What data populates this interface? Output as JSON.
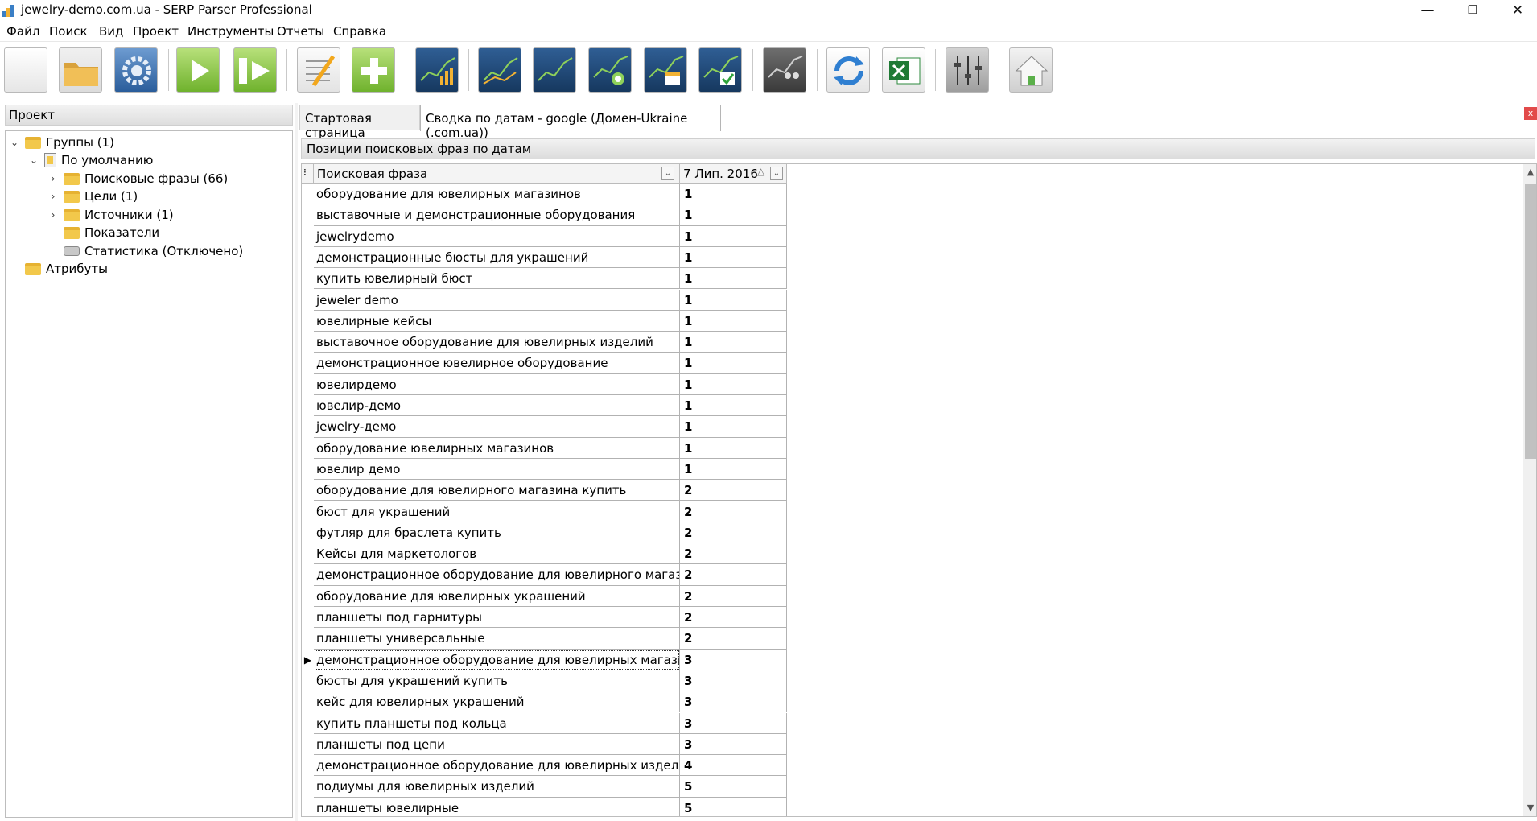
{
  "window": {
    "title": "jewelry-demo.com.ua - SERP Parser Professional",
    "minimize": "—",
    "restore": "❐",
    "close": "✕"
  },
  "menu": [
    "Файл",
    "Поиск",
    "Вид",
    "Проект",
    "Инструменты",
    "Отчеты",
    "Справка"
  ],
  "toolbar": {
    "icons": [
      "new-project-icon",
      "open-folder-icon",
      "settings-gear-icon",
      "run-icon",
      "run-checklist-icon",
      "edit-notes-icon",
      "add-icon",
      "chart-bars-icon",
      "chart-line-icon",
      "chart-line-2-icon",
      "chart-target-icon",
      "chart-calendar-icon",
      "chart-check-icon",
      "chart-users-icon",
      "refresh-icon",
      "excel-icon",
      "equalizer-icon",
      "home-icon"
    ]
  },
  "left_panel": {
    "header": "Проект",
    "tree": [
      {
        "label": "Группы (1)",
        "expander": "⌄"
      },
      {
        "label": "По умолчанию",
        "expander": "⌄"
      },
      {
        "label": "Поисковые фразы (66)",
        "expander": "›"
      },
      {
        "label": "Цели (1)",
        "expander": "›"
      },
      {
        "label": "Источники (1)",
        "expander": "›"
      },
      {
        "label": "Показатели",
        "expander": ""
      },
      {
        "label": "Статистика (Отключено)",
        "expander": ""
      },
      {
        "label": "Атрибуты",
        "expander": ""
      }
    ]
  },
  "tabs": [
    {
      "label": "Стартовая страница"
    },
    {
      "label": "Сводка по датам - google (Домен-Ukraine (.com.ua))"
    }
  ],
  "tab_close": "x",
  "section_title": "Позиции поисковых фраз по датам",
  "grid": {
    "columns": [
      "Поисковая фраза",
      "7 Лип. 2016"
    ],
    "sort_indicator": "△",
    "filter_glyph": "⌄",
    "selected_marker": "▶",
    "rows": [
      {
        "phrase": "оборудование для ювелирных магазинов",
        "pos": "1"
      },
      {
        "phrase": "выставочные и демонстрационные оборудования",
        "pos": "1"
      },
      {
        "phrase": "jewelrydemo",
        "pos": "1"
      },
      {
        "phrase": "демонстрационные бюсты для украшений",
        "pos": "1"
      },
      {
        "phrase": "купить ювелирный бюст",
        "pos": "1"
      },
      {
        "phrase": "jeweler demo",
        "pos": "1"
      },
      {
        "phrase": "ювелирные кейсы",
        "pos": "1"
      },
      {
        "phrase": "выставочное оборудование для ювелирных изделий",
        "pos": "1"
      },
      {
        "phrase": "демонстрационное ювелирное оборудование",
        "pos": "1"
      },
      {
        "phrase": "ювелирдемо",
        "pos": "1"
      },
      {
        "phrase": "ювелир-демо",
        "pos": "1"
      },
      {
        "phrase": "jewelry-демо",
        "pos": "1"
      },
      {
        "phrase": "оборудование ювелирных магазинов",
        "pos": "1"
      },
      {
        "phrase": "ювелир демо",
        "pos": "1"
      },
      {
        "phrase": "оборудование для ювелирного магазина купить",
        "pos": "2"
      },
      {
        "phrase": "бюст для украшений",
        "pos": "2"
      },
      {
        "phrase": "футляр для браслета купить",
        "pos": "2"
      },
      {
        "phrase": "Кейсы для маркетологов",
        "pos": "2"
      },
      {
        "phrase": "демонстрационное оборудование для ювелирного магазина",
        "pos": "2"
      },
      {
        "phrase": "оборудование для ювелирных украшений",
        "pos": "2"
      },
      {
        "phrase": "планшеты под гарнитуры",
        "pos": "2"
      },
      {
        "phrase": "планшеты универсальные",
        "pos": "2"
      },
      {
        "phrase": "демонстрационное оборудование для ювелирных магазинов",
        "pos": "3"
      },
      {
        "phrase": "бюсты для украшений купить",
        "pos": "3"
      },
      {
        "phrase": "кейс для ювелирных украшений",
        "pos": "3"
      },
      {
        "phrase": "купить планшеты под кольца",
        "pos": "3"
      },
      {
        "phrase": "планшеты под цепи",
        "pos": "3"
      },
      {
        "phrase": "демонстрационное оборудование для ювелирных изделий",
        "pos": "4"
      },
      {
        "phrase": "подиумы для ювелирных изделий",
        "pos": "5"
      },
      {
        "phrase": "планшеты ювелирные",
        "pos": "5"
      }
    ]
  },
  "scrollbar": {
    "up": "▲",
    "down": "▼"
  },
  "colors": {
    "accent": "#3a7fc6",
    "folder": "#f2c84b",
    "close_tab": "#e24a4a"
  }
}
